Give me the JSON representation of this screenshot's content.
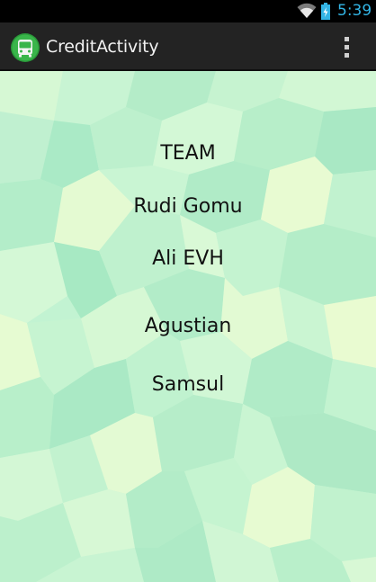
{
  "status_bar": {
    "time": "5:39",
    "icons": [
      "wifi-icon",
      "battery-charging-icon"
    ],
    "accent_color": "#33b5e5"
  },
  "action_bar": {
    "title": "CreditActivity",
    "app_icon": "bus-icon",
    "overflow_icon": "more-vertical-icon"
  },
  "credits": {
    "heading": "TEAM",
    "names": [
      "Rudi Gomu",
      "Ali EVH",
      "Agustian",
      "Samsul"
    ]
  },
  "colors": {
    "background_light": "#e6fbd2",
    "background_mid": "#b8f2cc",
    "background_dark": "#9de8c4",
    "action_bar": "#232323"
  }
}
